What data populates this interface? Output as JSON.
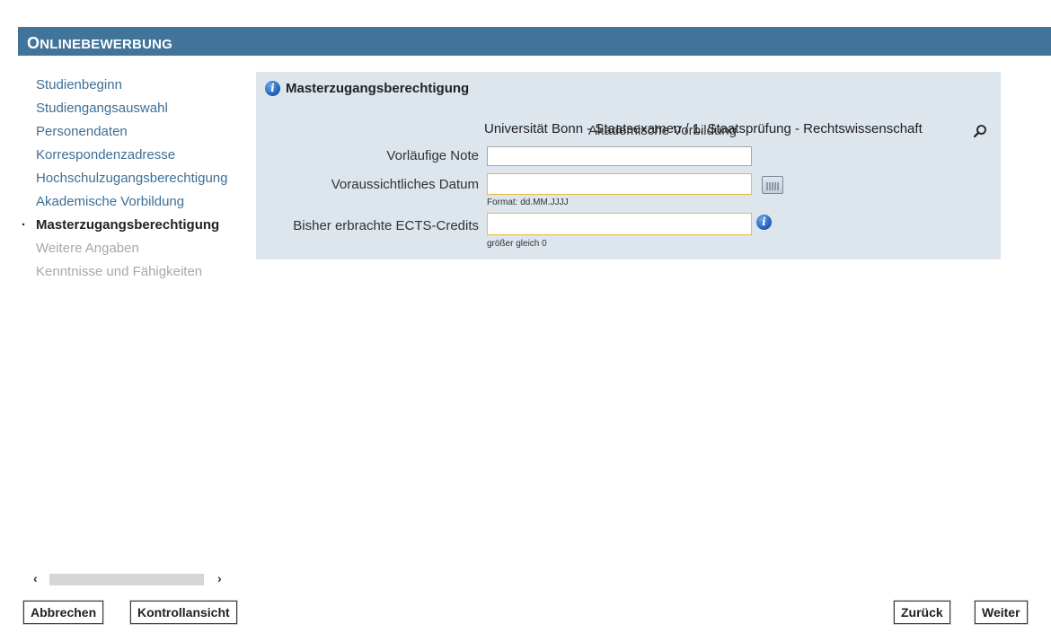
{
  "header": {
    "title_first": "O",
    "title_rest": "NLINEBEWERBUNG"
  },
  "sidebar": {
    "items": [
      {
        "label": "Studienbeginn",
        "state": "link"
      },
      {
        "label": "Studiengangsauswahl",
        "state": "link"
      },
      {
        "label": "Personendaten",
        "state": "link"
      },
      {
        "label": "Korrespondenzadresse",
        "state": "link"
      },
      {
        "label": "Hochschulzugangsberechtigung",
        "state": "link"
      },
      {
        "label": "Akademische Vorbildung",
        "state": "link"
      },
      {
        "label": "Masterzugangsberechtigung",
        "state": "active"
      },
      {
        "label": "Weitere Angaben",
        "state": "disabled"
      },
      {
        "label": "Kenntnisse und Fähigkeiten",
        "state": "disabled"
      }
    ],
    "active_bullet": "·"
  },
  "panel": {
    "title": "Masterzugangsberechtigung",
    "akademische_vorbildung": {
      "label": "Akademische Vorbildung",
      "value": "Universität Bonn - Staatsexamen / 1. Staatsprüfung - Rechtswissenschaft"
    },
    "vorlaeufige_note": {
      "label": "Vorläufige Note",
      "value": ""
    },
    "voraussichtliches_datum": {
      "label": "Voraussichtliches Datum",
      "value": "",
      "hint": "Format: dd.MM.JJJJ"
    },
    "ects": {
      "label": "Bisher erbrachte ECTS-Credits",
      "value": "",
      "hint": "größer gleich 0"
    }
  },
  "icons": {
    "info": "info-icon",
    "calendar": "calendar-icon",
    "search": "magnifier-icon",
    "scroll_left": "‹",
    "scroll_right": "›"
  },
  "buttons": {
    "abbrechen": "Abbrechen",
    "kontrollansicht": "Kontrollansicht",
    "zurueck": "Zurück",
    "weiter": "Weiter"
  },
  "colors": {
    "header_bg": "#41749a",
    "panel_bg": "#dde5ed",
    "link": "#3e6f96",
    "disabled": "#a8a8a8",
    "required_border": "#e8b84a"
  }
}
